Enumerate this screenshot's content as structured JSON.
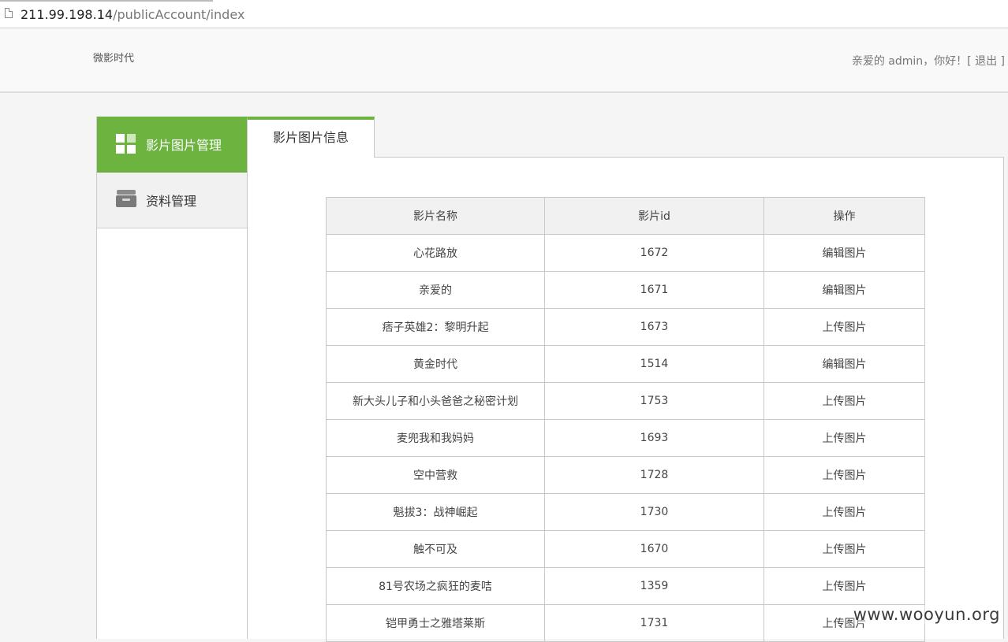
{
  "browser": {
    "url_host": "211.99.198.14",
    "url_path": "/publicAccount/index"
  },
  "header": {
    "brand": "微影时代",
    "greeting": "亲爱的 admin，你好！",
    "logout_label": "[ 退出 ]"
  },
  "sidebar": {
    "items": [
      {
        "label": "影片图片管理",
        "icon": "grid-tiles-icon",
        "active": true
      },
      {
        "label": "资料管理",
        "icon": "inbox-icon",
        "active": false
      }
    ]
  },
  "main": {
    "tab_label": "影片图片信息",
    "table": {
      "headers": [
        "影片名称",
        "影片id",
        "操作"
      ],
      "rows": [
        [
          "心花路放",
          "1672",
          "编辑图片"
        ],
        [
          "亲爱的",
          "1671",
          "编辑图片"
        ],
        [
          "痞子英雄2：黎明升起",
          "1673",
          "上传图片"
        ],
        [
          "黄金时代",
          "1514",
          "编辑图片"
        ],
        [
          "新大头儿子和小头爸爸之秘密计划",
          "1753",
          "上传图片"
        ],
        [
          "麦兜我和我妈妈",
          "1693",
          "上传图片"
        ],
        [
          "空中营救",
          "1728",
          "上传图片"
        ],
        [
          "魁拔3：战神崛起",
          "1730",
          "上传图片"
        ],
        [
          "触不可及",
          "1670",
          "上传图片"
        ],
        [
          "81号农场之疯狂的麦咭",
          "1359",
          "上传图片"
        ],
        [
          "铠甲勇士之雅塔莱斯",
          "1731",
          "上传图片"
        ]
      ]
    }
  },
  "watermark": "www.wooyun.org",
  "colors": {
    "accent": "#6db33f",
    "border": "#c8c8c8"
  }
}
